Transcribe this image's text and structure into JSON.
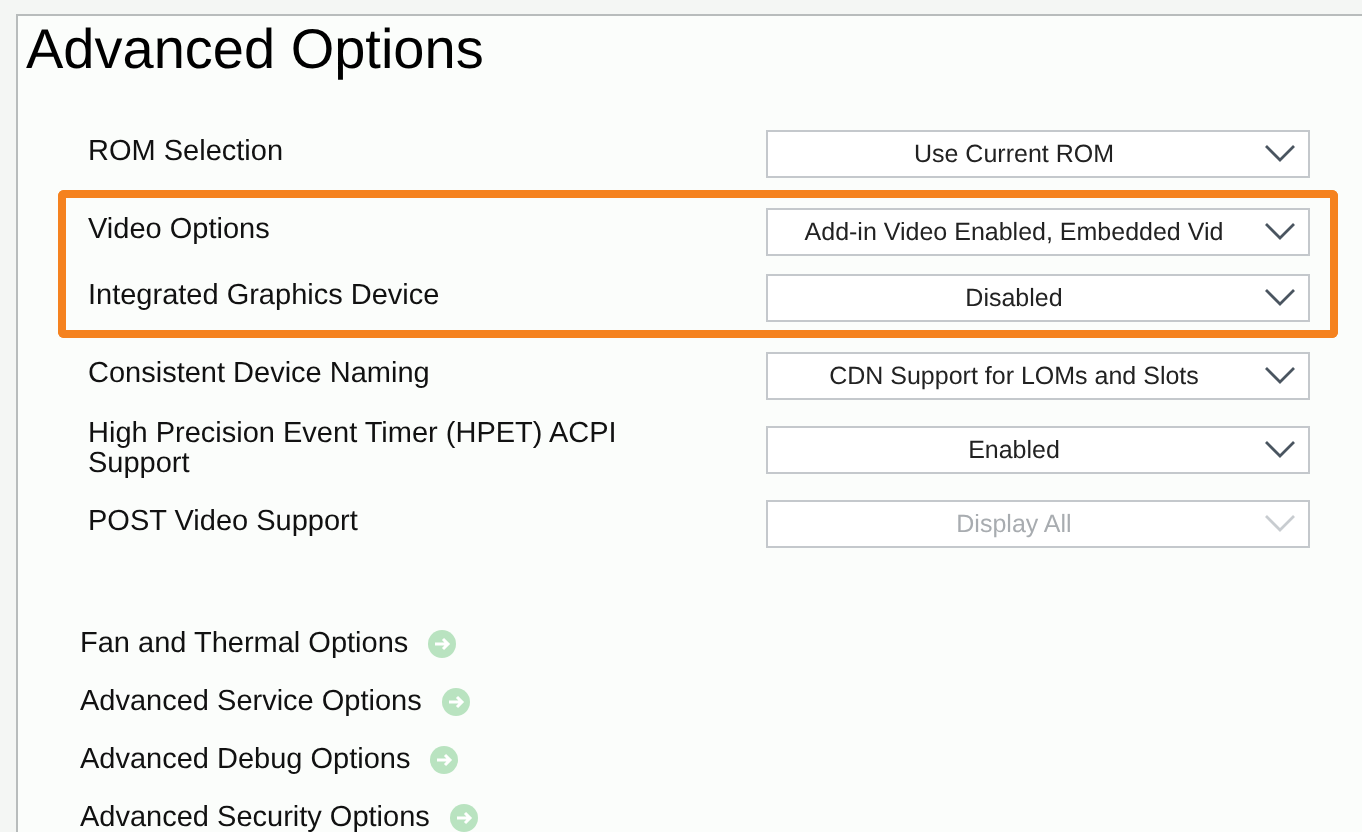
{
  "window": {
    "title": "Advanced Options"
  },
  "settings": [
    {
      "label": "ROM Selection",
      "value": "Use Current ROM",
      "disabled": false,
      "highlighted": false
    },
    {
      "label": "Video Options",
      "value": "Add-in Video Enabled, Embedded Vid",
      "disabled": false,
      "highlighted": true
    },
    {
      "label": "Integrated Graphics Device",
      "value": "Disabled",
      "disabled": false,
      "highlighted": true
    },
    {
      "label": "Consistent Device Naming",
      "value": "CDN Support for LOMs and Slots",
      "disabled": false,
      "highlighted": false
    },
    {
      "label": "High Precision Event Timer (HPET) ACPI Support",
      "value": "Enabled",
      "disabled": false,
      "highlighted": false
    },
    {
      "label": "POST Video Support",
      "value": "Display All",
      "disabled": true,
      "highlighted": false
    }
  ],
  "links": [
    "Fan and Thermal Options",
    "Advanced Service Options",
    "Advanced Debug Options",
    "Advanced Security Options"
  ]
}
